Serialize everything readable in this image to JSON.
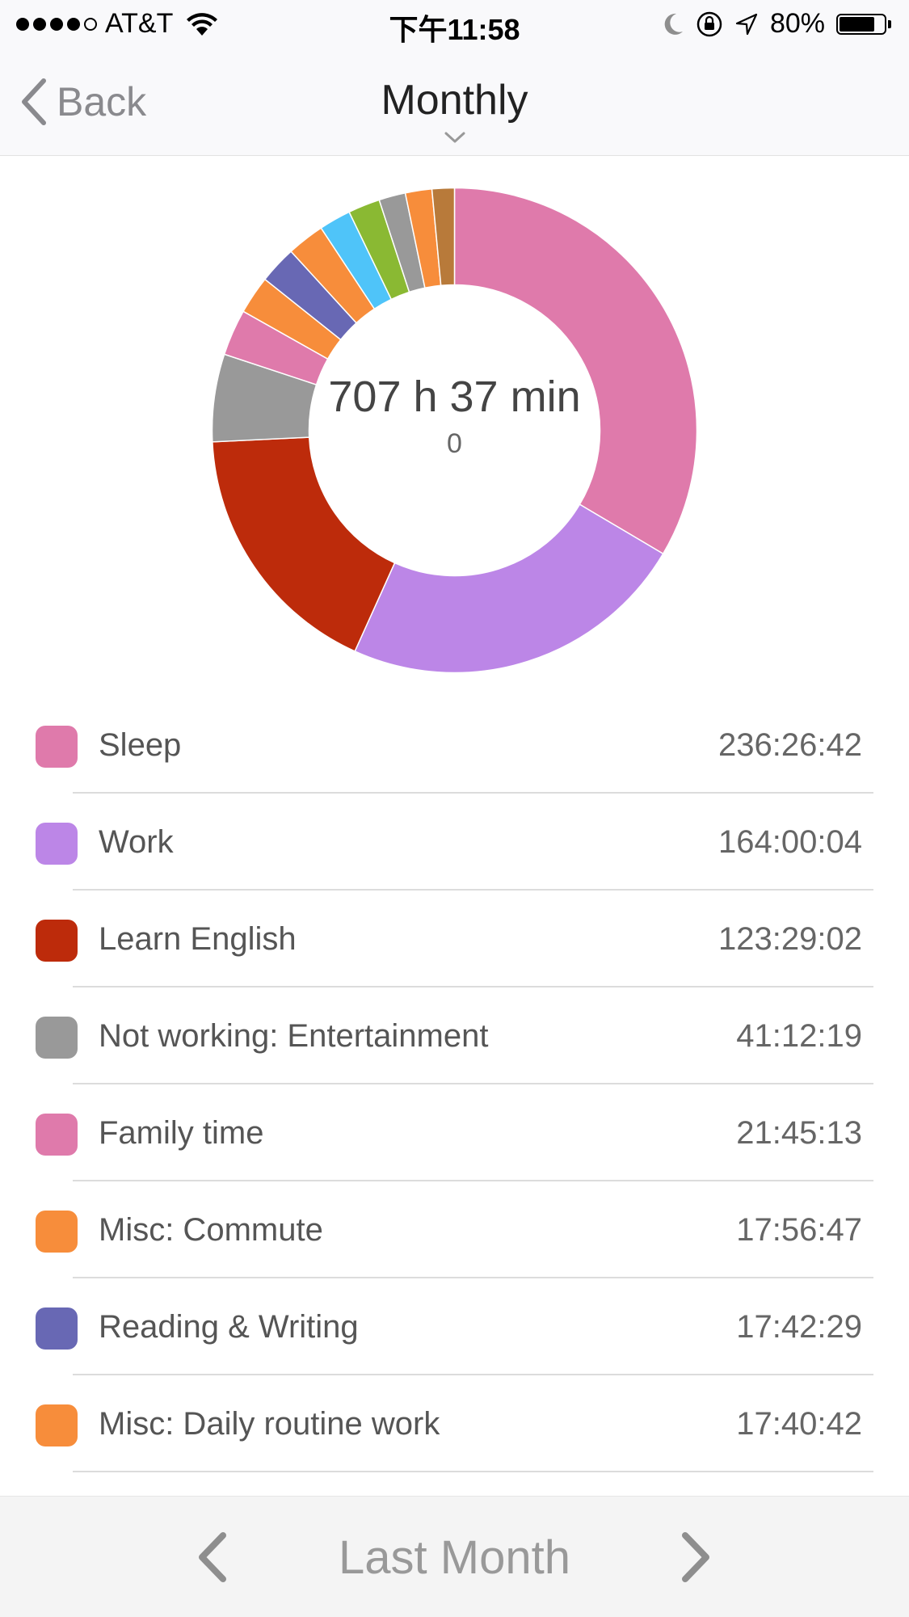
{
  "status_bar": {
    "carrier": "AT&T",
    "time": "下午11:58",
    "battery_percent": "80%",
    "battery_level": 0.8
  },
  "nav": {
    "back_label": "Back",
    "title": "Monthly"
  },
  "summary": {
    "total": "707 h 37 min",
    "sub": "0"
  },
  "chart_data": {
    "type": "pie",
    "style": "donut",
    "title": "",
    "slices": [
      {
        "name": "Sleep",
        "value": 236.445,
        "color": "#df7aab"
      },
      {
        "name": "Work",
        "value": 164.001,
        "color": "#bc86e7"
      },
      {
        "name": "Learn English",
        "value": 123.484,
        "color": "#bd2b0b"
      },
      {
        "name": "Not working: Entertainment",
        "value": 41.205,
        "color": "#999999"
      },
      {
        "name": "Family time",
        "value": 21.754,
        "color": "#df7aab"
      },
      {
        "name": "Misc: Commute",
        "value": 17.946,
        "color": "#f78d3b"
      },
      {
        "name": "Reading & Writing",
        "value": 17.708,
        "color": "#6868b4"
      },
      {
        "name": "Misc: Daily routine work",
        "value": 17.678,
        "color": "#f78d3b"
      },
      {
        "name": "",
        "value": 15.0,
        "color": "#4fc4f9"
      },
      {
        "name": "",
        "value": 15.0,
        "color": "#8ab933"
      },
      {
        "name": "",
        "value": 12.5,
        "color": "#999999"
      },
      {
        "name": "",
        "value": 12.5,
        "color": "#f78d3b"
      },
      {
        "name": "",
        "value": 10.5,
        "color": "#b87a3a"
      }
    ]
  },
  "categories": [
    {
      "name": "Sleep",
      "duration": "236:26:42",
      "color": "#df7aab"
    },
    {
      "name": "Work",
      "duration": "164:00:04",
      "color": "#bc86e7"
    },
    {
      "name": "Learn English",
      "duration": "123:29:02",
      "color": "#bd2b0b"
    },
    {
      "name": "Not working: Entertainment",
      "duration": "41:12:19",
      "color": "#999999"
    },
    {
      "name": "Family time",
      "duration": "21:45:13",
      "color": "#df7aab"
    },
    {
      "name": "Misc: Commute",
      "duration": "17:56:47",
      "color": "#f78d3b"
    },
    {
      "name": "Reading & Writing",
      "duration": "17:42:29",
      "color": "#6868b4"
    },
    {
      "name": "Misc: Daily routine work",
      "duration": "17:40:42",
      "color": "#f78d3b"
    }
  ],
  "bottom": {
    "period_label": "Last Month"
  }
}
